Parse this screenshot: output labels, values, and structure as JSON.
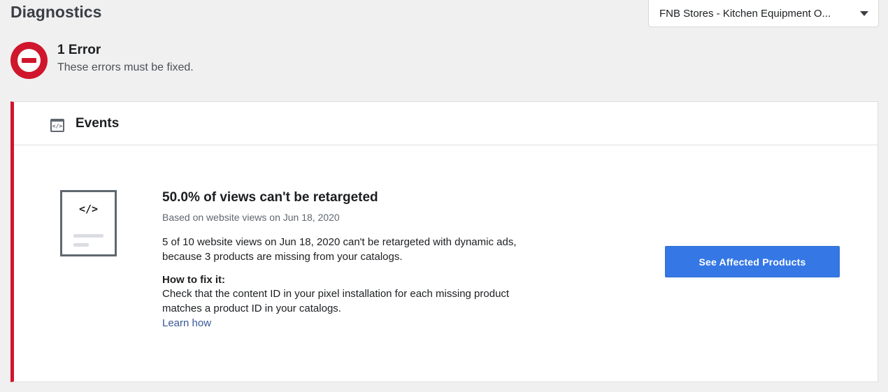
{
  "page": {
    "title": "Diagnostics"
  },
  "catalog_selector": {
    "selected": "FNB Stores - Kitchen Equipment O...",
    "icon": "caret-down-icon"
  },
  "error_summary": {
    "icon": "error-stop-icon",
    "count_label": "1 Error",
    "description": "These errors must be fixed."
  },
  "colors": {
    "error": "#d0162c",
    "primary": "#3578e5",
    "link": "#385898"
  },
  "events_card": {
    "icon": "code-window-icon",
    "title": "Events",
    "illustration_code": "</>",
    "headline": "50.0% of views can't be retargeted",
    "subline": "Based on website views on Jun 18, 2020",
    "body_line1": "5 of 10 website views on Jun 18, 2020 can't be retargeted with dynamic ads,",
    "body_line2": "because 3 products are missing from your catalogs.",
    "fix_title": "How to fix it:",
    "fix_line1": "Check that the content ID in your pixel installation for each missing product",
    "fix_line2": "matches a product ID in your catalogs.",
    "learn_link": "Learn how",
    "cta_label": "See Affected Products"
  }
}
